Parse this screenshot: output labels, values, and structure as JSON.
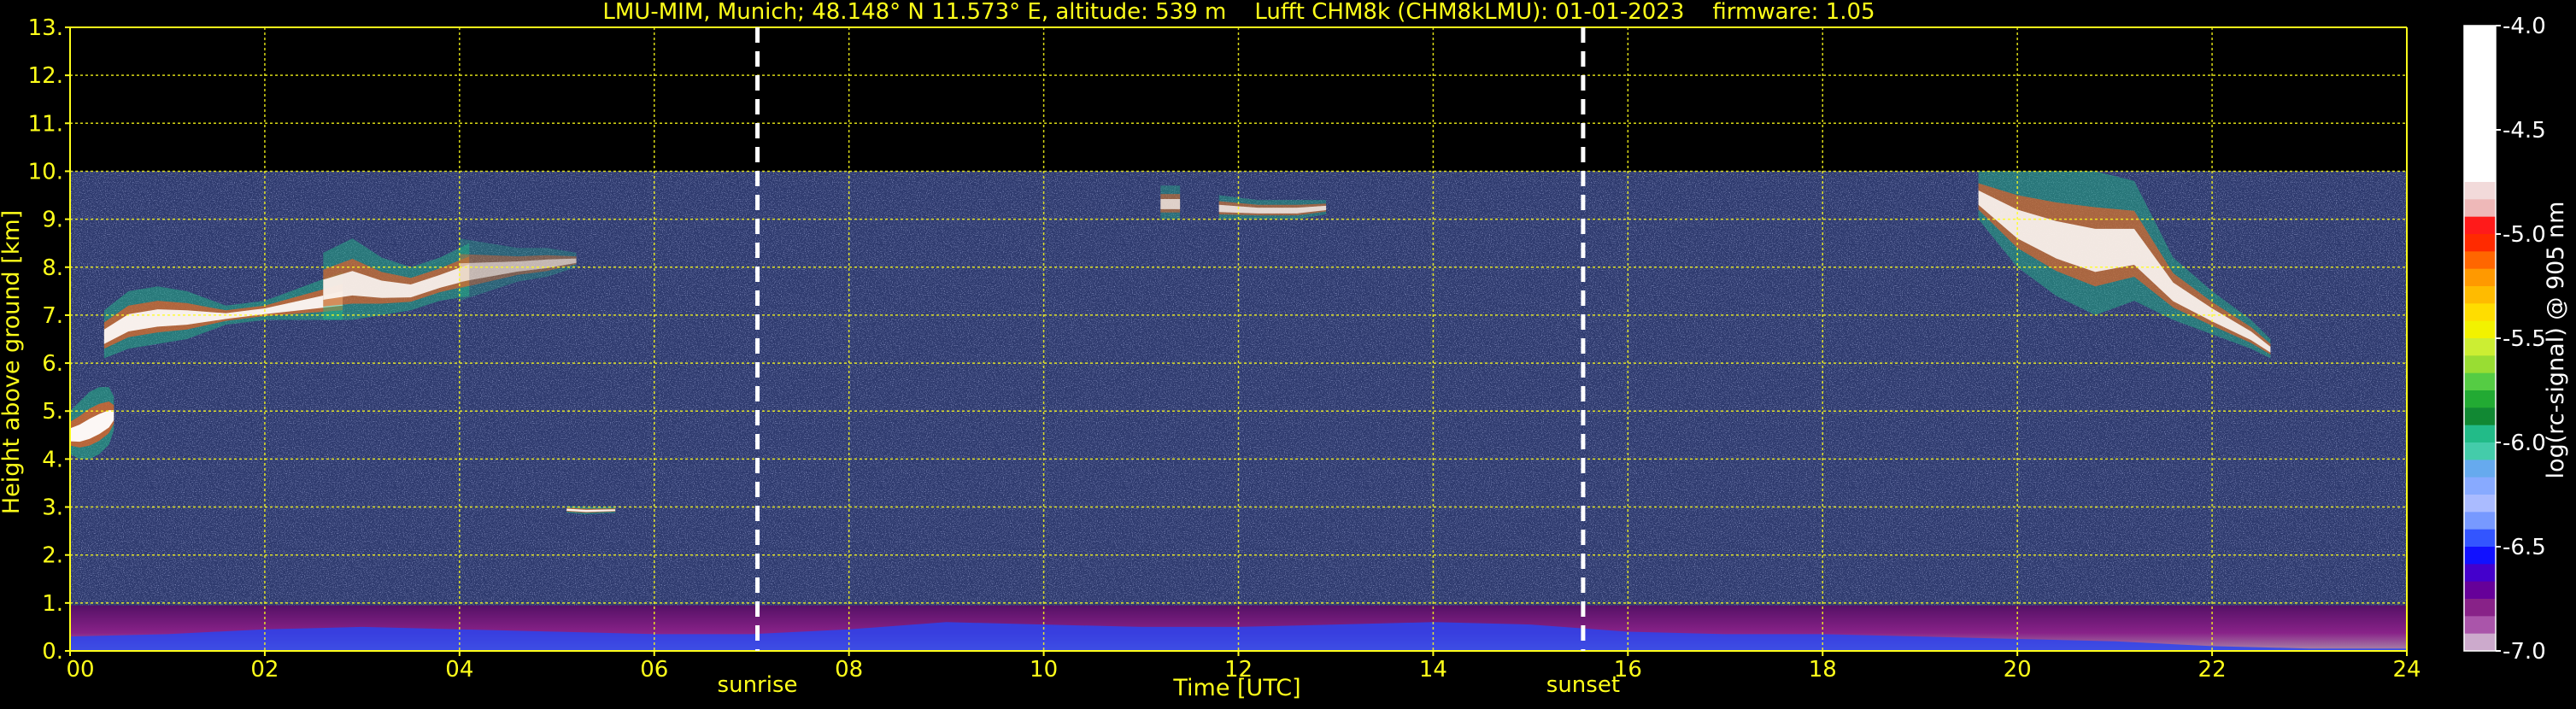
{
  "chart_data": {
    "type": "heatmap",
    "title": "LMU-MIM, Munich; 48.148° N 11.573° E, altitude: 539 m    Lufft CHM8k (CHM8kLMU): 01-01-2023    firmware: 1.05",
    "xlabel": "Time [UTC]",
    "ylabel": "Height above ground [km]",
    "xlim": [
      0,
      24
    ],
    "ylim": [
      0,
      13
    ],
    "x_ticks": [
      "00",
      "02",
      "04",
      "06",
      "08",
      "10",
      "12",
      "14",
      "16",
      "18",
      "20",
      "22",
      "24"
    ],
    "y_ticks": [
      "0.",
      "1.",
      "2.",
      "3.",
      "4.",
      "5.",
      "6.",
      "7.",
      "8.",
      "9.",
      "10.",
      "11.",
      "12.",
      "13."
    ],
    "grid": true,
    "colorbar": {
      "label": "log(rc-signal) @ 905 nm",
      "range": [
        -7.0,
        -4.0
      ],
      "ticks": [
        "-4.0",
        "-4.5",
        "-5.0",
        "-5.5",
        "-6.0",
        "-6.5",
        "-7.0"
      ],
      "levels": [
        "#ffffff",
        "#ffffff",
        "#ffffff",
        "#ffffff",
        "#ffffff",
        "#ffffff",
        "#ffffff",
        "#ffffff",
        "#ffffff",
        "#f2dada",
        "#eeb8b8",
        "#ff1a1a",
        "#ff2a00",
        "#ff6600",
        "#ff9900",
        "#ffbb00",
        "#ffdd00",
        "#f2f200",
        "#ccee33",
        "#99dd33",
        "#55cc44",
        "#22aa33",
        "#118833",
        "#22bb88",
        "#44ccaa",
        "#66aaee",
        "#88aaff",
        "#aabbff",
        "#7799ff",
        "#3355ff",
        "#1111ff",
        "#4400cc",
        "#660099",
        "#882288",
        "#aa55aa",
        "#ccaacc"
      ]
    },
    "events": [
      {
        "label": "sunrise",
        "time": 7.06
      },
      {
        "label": "sunset",
        "time": 15.54
      }
    ],
    "measurement_top_km": 10,
    "background_noise_color": "#2e3a6e",
    "boundary_layer": {
      "time": [
        0,
        1,
        2,
        3,
        4,
        5,
        6,
        7,
        8,
        9,
        10,
        11,
        12,
        13,
        14,
        15,
        16,
        17,
        18,
        19,
        20,
        21,
        22,
        23,
        24
      ],
      "layer_top_km": [
        0.95,
        0.95,
        0.95,
        0.95,
        0.95,
        0.95,
        0.95,
        0.95,
        0.95,
        0.95,
        0.95,
        0.95,
        0.95,
        0.95,
        0.95,
        0.95,
        0.95,
        0.95,
        0.95,
        0.95,
        0.95,
        0.95,
        0.95,
        0.95,
        0.95
      ],
      "aerosol_top_km": [
        0.3,
        0.35,
        0.45,
        0.5,
        0.45,
        0.4,
        0.35,
        0.35,
        0.45,
        0.6,
        0.55,
        0.5,
        0.5,
        0.55,
        0.6,
        0.55,
        0.4,
        0.35,
        0.35,
        0.3,
        0.25,
        0.2,
        0.1,
        0.05,
        0.05
      ]
    },
    "cloud_layers": [
      {
        "time": [
          0,
          0.1,
          0.2,
          0.3,
          0.4,
          0.45
        ],
        "base_km": [
          4.1,
          4.0,
          4.0,
          4.1,
          4.3,
          4.6
        ],
        "top_km": [
          5.0,
          5.2,
          5.4,
          5.5,
          5.5,
          5.3
        ],
        "intensity": 0.95
      },
      {
        "time": [
          0.35,
          0.6,
          0.9,
          1.2,
          1.6,
          2.0,
          2.4,
          2.8
        ],
        "base_km": [
          6.1,
          6.3,
          6.4,
          6.5,
          6.8,
          6.9,
          6.9,
          6.9
        ],
        "top_km": [
          7.1,
          7.5,
          7.6,
          7.5,
          7.2,
          7.3,
          7.6,
          7.9
        ],
        "intensity": 0.9
      },
      {
        "time": [
          2.6,
          2.9,
          3.2,
          3.5,
          3.8,
          4.1
        ],
        "base_km": [
          6.9,
          6.9,
          7.0,
          7.1,
          7.3,
          7.4
        ],
        "top_km": [
          8.3,
          8.6,
          8.2,
          8.0,
          8.2,
          8.5
        ],
        "intensity": 0.85
      },
      {
        "time": [
          4.0,
          4.3,
          4.6,
          4.9,
          5.2
        ],
        "base_km": [
          7.3,
          7.5,
          7.7,
          7.8,
          8.0
        ],
        "top_km": [
          8.6,
          8.5,
          8.4,
          8.4,
          8.3
        ],
        "intensity": 0.55
      },
      {
        "time": [
          5.1,
          5.3,
          5.6
        ],
        "base_km": [
          2.88,
          2.85,
          2.88
        ],
        "top_km": [
          3.02,
          3.0,
          3.0
        ],
        "intensity": 0.9
      },
      {
        "time": [
          11.2,
          11.4
        ],
        "base_km": [
          9.0,
          9.0
        ],
        "top_km": [
          9.7,
          9.7
        ],
        "intensity": 0.7
      },
      {
        "time": [
          11.8,
          12.2,
          12.6,
          12.9
        ],
        "base_km": [
          9.0,
          9.0,
          9.0,
          9.1
        ],
        "top_km": [
          9.5,
          9.4,
          9.4,
          9.4
        ],
        "intensity": 0.75
      },
      {
        "time": [
          19.6,
          20.0,
          20.4,
          20.8,
          21.2,
          21.6,
          22.0,
          22.4,
          22.6
        ],
        "base_km": [
          9.0,
          8.0,
          7.4,
          7.0,
          7.3,
          6.9,
          6.6,
          6.3,
          6.1
        ],
        "top_km": [
          10.0,
          10.0,
          10.0,
          10.0,
          9.8,
          8.2,
          7.5,
          6.9,
          6.5
        ],
        "intensity": 0.85
      }
    ]
  }
}
